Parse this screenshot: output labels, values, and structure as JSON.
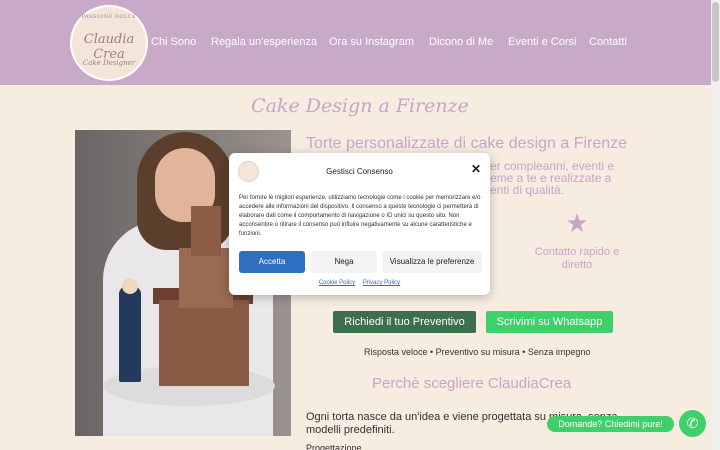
{
  "logo": {
    "tagline": "PASSIONE DOLCE",
    "name": "Claudia Crea",
    "subtitle": "Cake Designer"
  },
  "nav": [
    {
      "label": "Chi Sono"
    },
    {
      "label": "Regala un'esperienza"
    },
    {
      "label": "Ora su Instagram"
    },
    {
      "label": "Dicono di Me"
    },
    {
      "label": "Eventi e Corsi"
    },
    {
      "label": "Contatti"
    }
  ],
  "hero": {
    "title": "Cake Design a Firenze",
    "heading": "Torte personalizzate di cake design a Firenze",
    "description": "er compleanni, eventi e\neme a te e realizzate a\nenti di qualità.",
    "icon": "star-icon",
    "feature_label": "Contatto rapido e diretto"
  },
  "cta": {
    "preventivo": "Richiedi il tuo Preventivo",
    "whatsapp": "Scrivimi su Whatsapp",
    "note": "Risposta veloce • Preventivo su misura • Senza impegno"
  },
  "why": {
    "heading": "Perchè scegliere ClaudiaCrea",
    "paragraph": "Ogni torta nasce da un'idea e viene progettata su misura, senza modelli predefiniti.",
    "bullet_fragment": "Progettazione dedicata"
  },
  "chat": {
    "bubble": "Domande? Chiedimi pure!",
    "icon": "whatsapp-icon"
  },
  "consent": {
    "title": "Gestisci Consenso",
    "body": "Per fornire le migliori esperienze, utilizziamo tecnologie come i cookie per memorizzare e/o accedere alle informazioni del dispositivo. Il consenso a queste tecnologie ci permetterà di elaborare dati come il comportamento di navigazione o ID unici su questo sito. Non acconsentire o ritirare il consenso può influire negativamente su alcune caratteristiche e funzioni.",
    "accept": "Accetta",
    "deny": "Nega",
    "preferences": "Visualizza le preferenze",
    "cookie_policy": "Cookie Policy",
    "privacy_policy": "Privacy Policy"
  },
  "colors": {
    "header": "#c8aac8",
    "background": "#f6ecdf",
    "accent": "#c9a4c9",
    "preventivo": "#3e6f4c",
    "whatsapp": "#3ed06a",
    "accept": "#2f6fc2"
  }
}
